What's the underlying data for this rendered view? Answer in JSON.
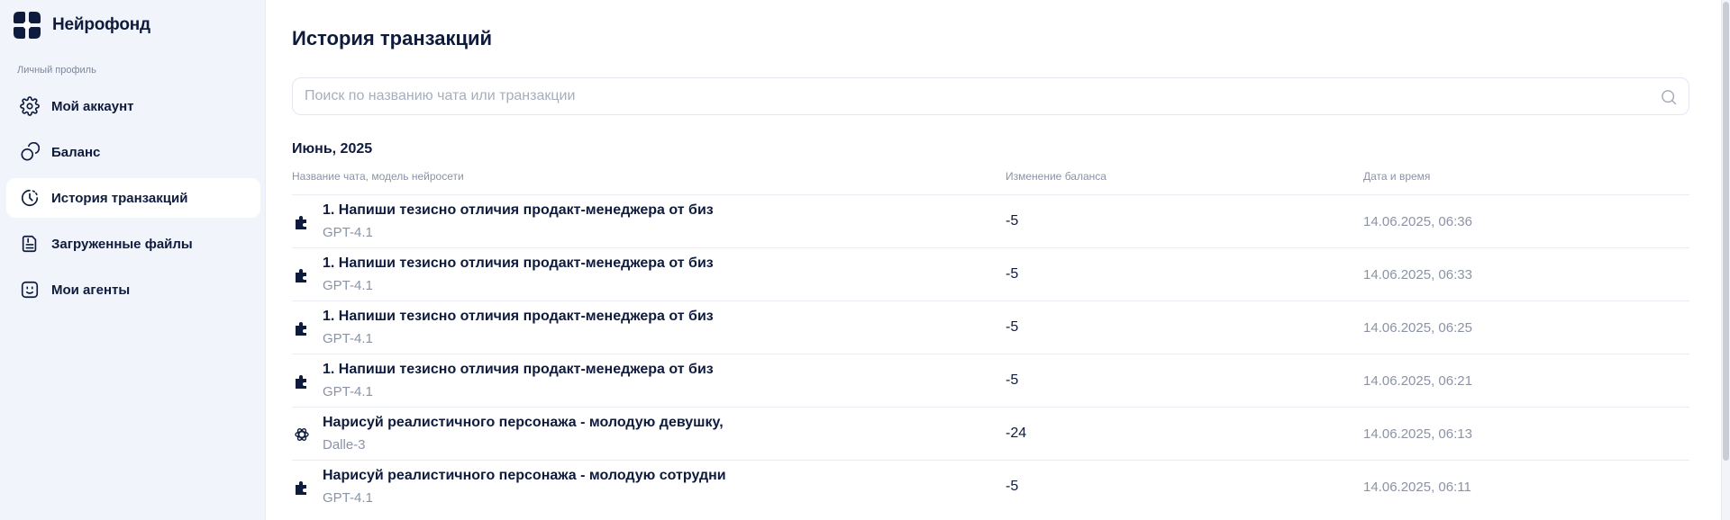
{
  "app": {
    "brand": "Нейрофонд"
  },
  "sidebar": {
    "section_label": "Личный профиль",
    "items": [
      {
        "label": "Мой аккаунт",
        "icon": "gear-icon",
        "active": false
      },
      {
        "label": "Баланс",
        "icon": "coins-icon",
        "active": false
      },
      {
        "label": "История транзакций",
        "icon": "history-icon",
        "active": true
      },
      {
        "label": "Загруженные файлы",
        "icon": "file-icon",
        "active": false
      },
      {
        "label": "Мои агенты",
        "icon": "agent-icon",
        "active": false
      }
    ]
  },
  "main": {
    "title": "История транзакций",
    "search": {
      "placeholder": "Поиск по названию чата или транзакции",
      "value": ""
    },
    "group_title": "Июнь, 2025",
    "columns": {
      "name": "Название чата, модель нейросети",
      "change": "Изменение баланса",
      "date": "Дата и время"
    },
    "rows": [
      {
        "title": "1. Напиши тезисно отличия продакт-менеджера от биз",
        "model": "GPT-4.1",
        "change": "-5",
        "date": "14.06.2025, 06:36",
        "icon": "puzzle-icon"
      },
      {
        "title": "1. Напиши тезисно отличия продакт-менеджера от биз",
        "model": "GPT-4.1",
        "change": "-5",
        "date": "14.06.2025, 06:33",
        "icon": "puzzle-icon"
      },
      {
        "title": "1. Напиши тезисно отличия продакт-менеджера от биз",
        "model": "GPT-4.1",
        "change": "-5",
        "date": "14.06.2025, 06:25",
        "icon": "puzzle-icon"
      },
      {
        "title": "1. Напиши тезисно отличия продакт-менеджера от биз",
        "model": "GPT-4.1",
        "change": "-5",
        "date": "14.06.2025, 06:21",
        "icon": "puzzle-icon"
      },
      {
        "title": "Нарисуй реалистичного персонажа - молодую девушку,",
        "model": "Dalle-3",
        "change": "-24",
        "date": "14.06.2025, 06:13",
        "icon": "openai-icon"
      },
      {
        "title": "Нарисуй реалистичного персонажа - молодую сотрудни",
        "model": "GPT-4.1",
        "change": "-5",
        "date": "14.06.2025, 06:11",
        "icon": "puzzle-icon"
      }
    ]
  }
}
